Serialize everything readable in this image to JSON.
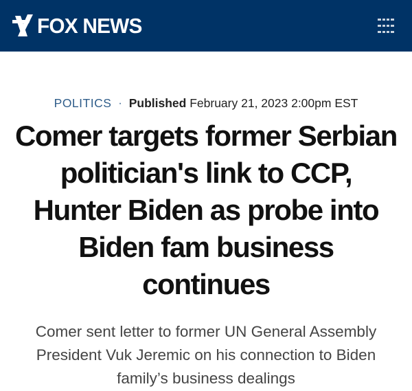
{
  "header": {
    "brand": "FOX NEWS",
    "brand_color": "#003366",
    "logo_icon": "fox-searchlight-mark",
    "menu_icon": "hamburger-menu-icon"
  },
  "meta": {
    "category": "POLITICS",
    "separator": "·",
    "published_label": "Published",
    "published_date": "February 21, 2023 2:00pm EST"
  },
  "article": {
    "headline": "Comer targets former Serbian politician's link to CCP, Hunter Biden as probe into Biden fam business continues",
    "subheadline": "Comer sent letter to former UN General Assembly President Vuk Jeremic on his connection to Biden family’s business dealings"
  }
}
